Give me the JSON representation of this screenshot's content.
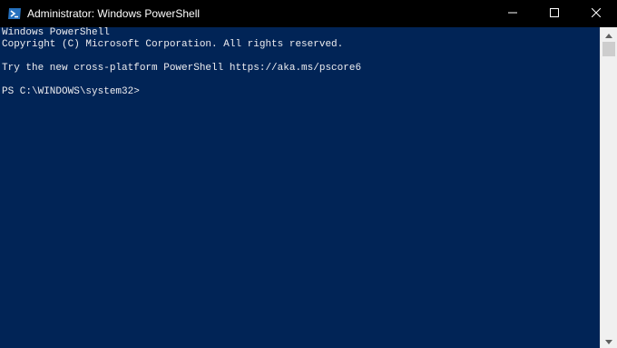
{
  "window": {
    "title": "Administrator: Windows PowerShell",
    "app_icon": "powershell-icon",
    "controls": {
      "minimize_icon": "minimize-icon",
      "maximize_icon": "maximize-icon",
      "close_icon": "close-icon"
    }
  },
  "console": {
    "background_color": "#012456",
    "text_color": "#eeedf0",
    "lines": [
      "Windows PowerShell",
      "Copyright (C) Microsoft Corporation. All rights reserved.",
      "",
      "Try the new cross-platform PowerShell https://aka.ms/pscore6",
      "",
      "PS C:\\WINDOWS\\system32>"
    ]
  },
  "scrollbar": {
    "up_icon": "scroll-up-arrow-icon",
    "down_icon": "scroll-down-arrow-icon"
  }
}
